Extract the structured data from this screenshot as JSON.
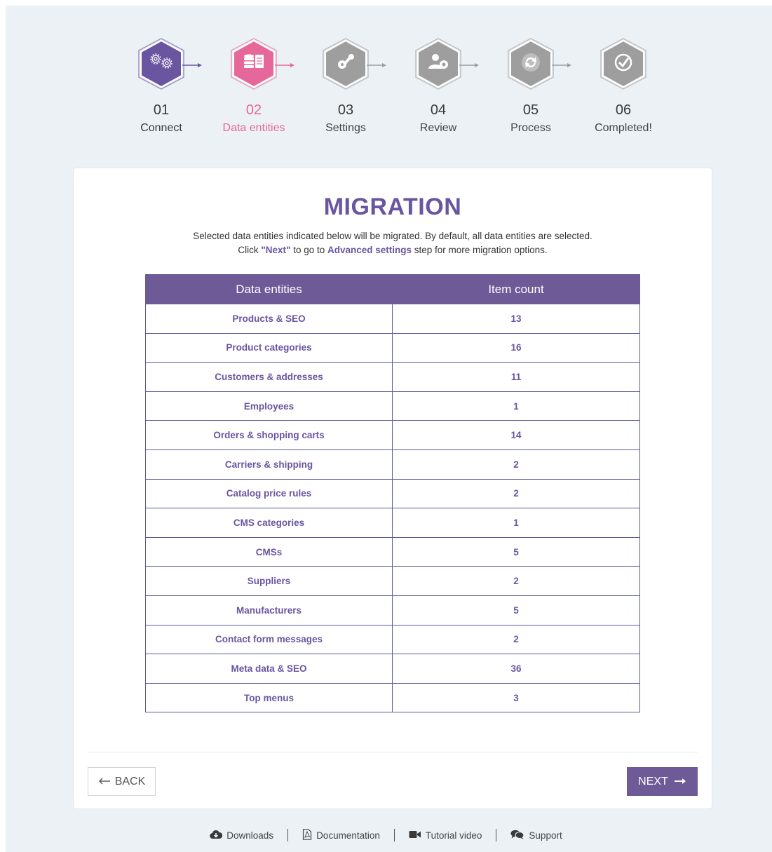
{
  "steps": [
    {
      "num": "01",
      "label": "Connect",
      "state": "done",
      "icon": "gear-network-icon"
    },
    {
      "num": "02",
      "label": "Data entities",
      "state": "active",
      "icon": "database-document-icon"
    },
    {
      "num": "03",
      "label": "Settings",
      "state": "pending",
      "icon": "wrench-gear-icon"
    },
    {
      "num": "04",
      "label": "Review",
      "state": "pending",
      "icon": "user-gear-icon"
    },
    {
      "num": "05",
      "label": "Process",
      "state": "pending",
      "icon": "refresh-icon"
    },
    {
      "num": "06",
      "label": "Completed!",
      "state": "pending",
      "icon": "check-circle-icon"
    }
  ],
  "colors": {
    "done": "#6a55a0",
    "active": "#e6689a",
    "pending": "#9e9e9e",
    "accent": "#6f5a98"
  },
  "card": {
    "title": "MIGRATION",
    "desc_line1": "Selected data entities indicated below will be migrated. By default, all data entities are selected.",
    "desc_click": "Click ",
    "desc_next": "\"Next\"",
    "desc_goto": " to go to ",
    "desc_advanced": "Advanced settings",
    "desc_rest": " step for more migration options."
  },
  "table": {
    "headers": [
      "Data entities",
      "Item count"
    ],
    "rows": [
      {
        "entity": "Products & SEO",
        "count": "13"
      },
      {
        "entity": "Product categories",
        "count": "16"
      },
      {
        "entity": "Customers & addresses",
        "count": "11"
      },
      {
        "entity": "Employees",
        "count": "1"
      },
      {
        "entity": "Orders & shopping carts",
        "count": "14"
      },
      {
        "entity": "Carriers & shipping",
        "count": "2"
      },
      {
        "entity": "Catalog price rules",
        "count": "2"
      },
      {
        "entity": "CMS categories",
        "count": "1"
      },
      {
        "entity": "CMSs",
        "count": "5"
      },
      {
        "entity": "Suppliers",
        "count": "2"
      },
      {
        "entity": "Manufacturers",
        "count": "5"
      },
      {
        "entity": "Contact form messages",
        "count": "2"
      },
      {
        "entity": "Meta data & SEO",
        "count": "36"
      },
      {
        "entity": "Top menus",
        "count": "3"
      }
    ]
  },
  "buttons": {
    "back": "BACK",
    "next": "NEXT"
  },
  "footer": {
    "downloads": "Downloads",
    "documentation": "Documentation",
    "tutorial": "Tutorial video",
    "support": "Support"
  }
}
